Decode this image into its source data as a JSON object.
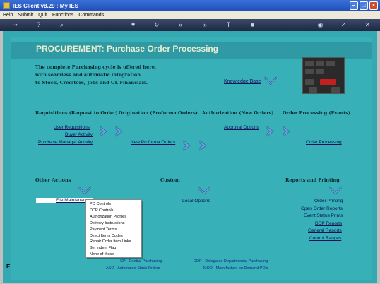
{
  "window": {
    "title": "IES Client v8.29 : My IES"
  },
  "menu": [
    "Help",
    "Submit",
    "Quit",
    "Functions",
    "Commands"
  ],
  "header": {
    "title": "PROCUREMENT: Purchase Order Processing",
    "intro": [
      "The complete Purchasing cycle is offered here,",
      "with seamless and automatic integration",
      "to Stock, Creditors, Jobs and GL Financials."
    ],
    "knowledge_base": "Knowledge Base"
  },
  "sections": {
    "requisitions": {
      "heading": "Requisitions (Request to Order)",
      "links": [
        "User Requisitions",
        "Buyer Activity",
        "Purchase Manager Activity"
      ]
    },
    "origination": {
      "heading": "Origination (Proforma Orders)",
      "links": [
        "New Proforma Orders"
      ]
    },
    "authorization": {
      "heading": "Authorization (New Orders)",
      "links": [
        "Approval Options"
      ]
    },
    "processing": {
      "heading": "Order Processing (Events)",
      "links": [
        "Order Processing"
      ]
    },
    "other": {
      "heading": "Other Actions",
      "link": "File Maintenance"
    },
    "custom": {
      "heading": "Custom",
      "link": "Local Options"
    },
    "reports": {
      "heading": "Reports and Printing",
      "links": [
        "Order Printing",
        "Open Order Reports",
        "Event Status Prints",
        "DDP Reports",
        "General Reports",
        "Control Ranges"
      ]
    }
  },
  "popup_menu": [
    "PO Controls",
    "DDP Controls",
    "Authorization Profiles",
    "Delivery Instructions",
    "Payment Terms",
    "Direct Items Codes",
    "Repair Order Item Links",
    "Set Indent Flag",
    "None of these"
  ],
  "legend": {
    "cp": "CP - Central Purchasing",
    "ddp": "DDP - Delegated Departmental Purchasing",
    "aso": "ASO - Automated Stock Orders",
    "mod": "MOD - Manufacture on Demand PO's"
  },
  "side_letter": "E"
}
